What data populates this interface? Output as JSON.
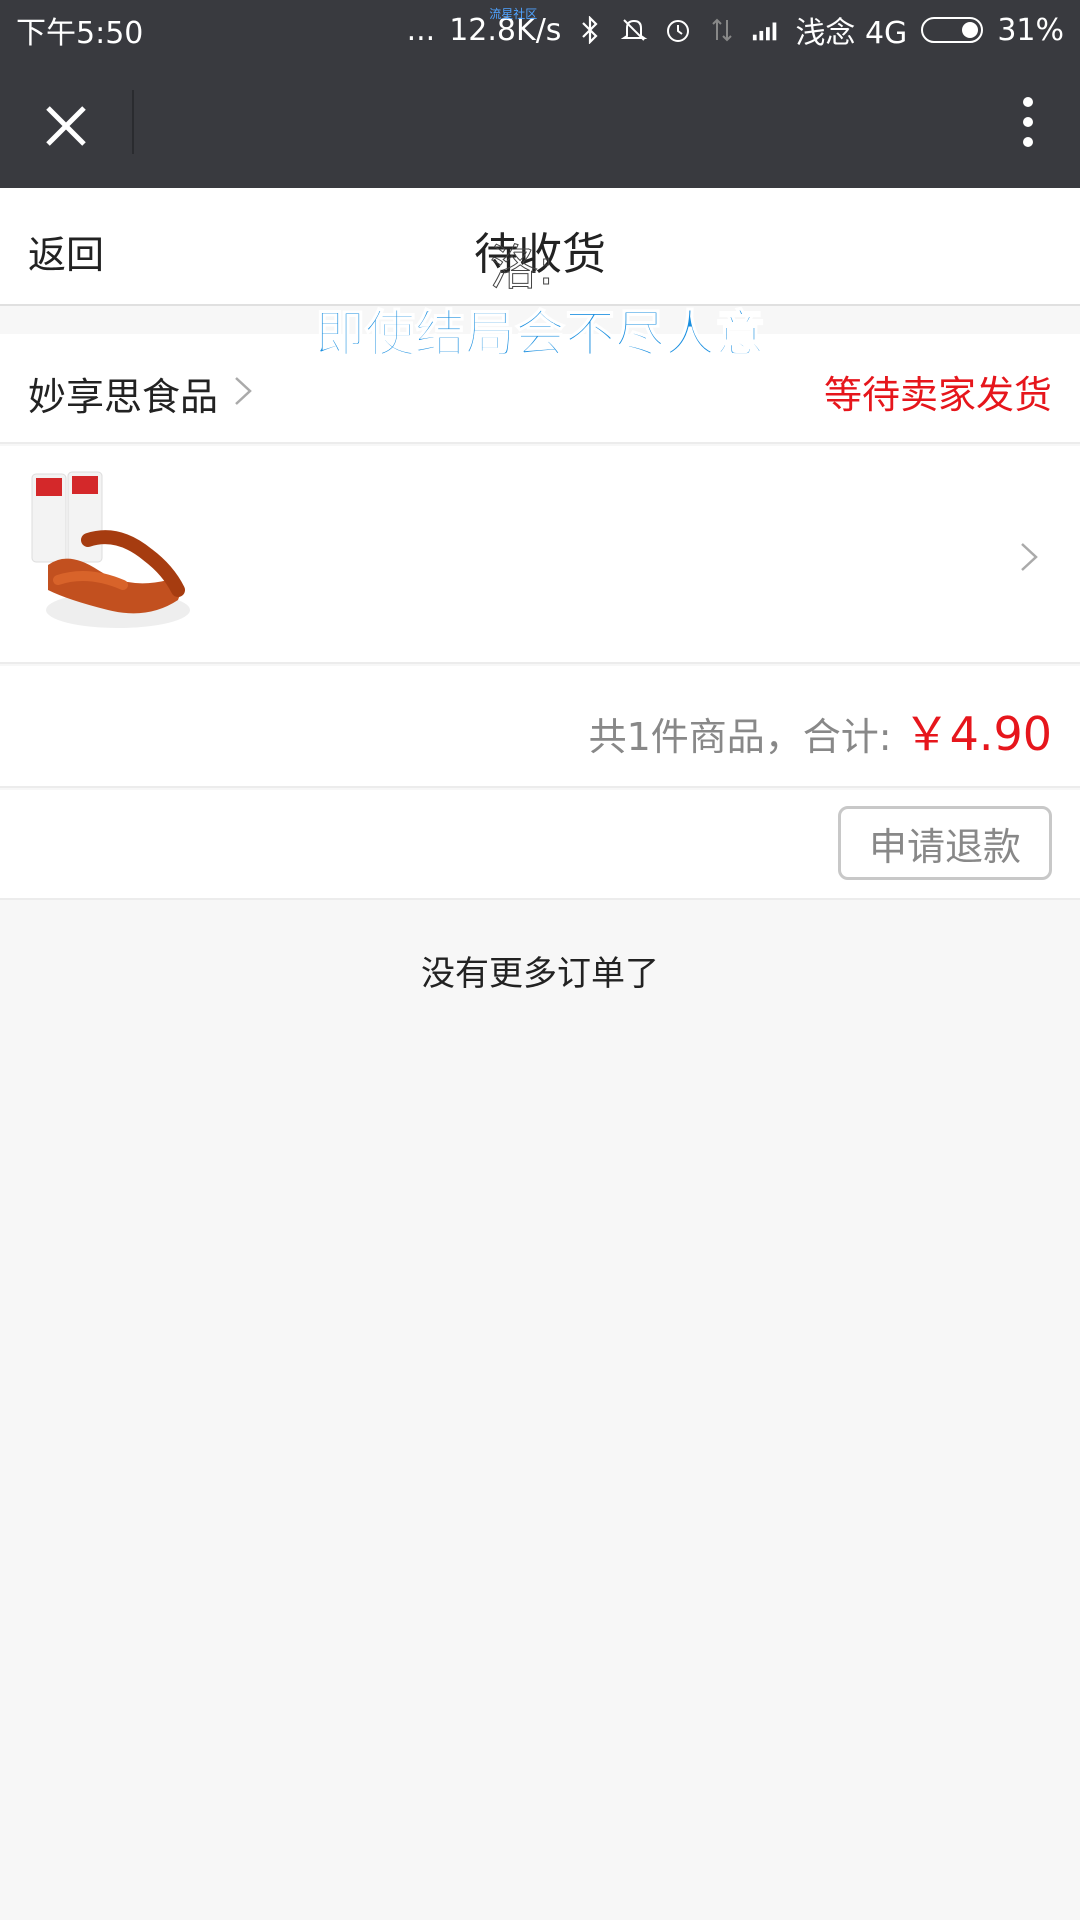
{
  "status_bar": {
    "time": "下午5:50",
    "dots": "...",
    "net_speed": "12.8K/s",
    "overlay_label": "流星社区",
    "carrier": "浅念 4G",
    "battery": "31%",
    "battery_level": 0.31
  },
  "header": {
    "back_label": "返回",
    "title": "待收货",
    "title_overlay": "洛:"
  },
  "overlay_caption": "即使结局会不尽人意",
  "order": {
    "shop_name": "妙享思食品",
    "status": "等待卖家发货",
    "summary_label": "共1件商品，合计:",
    "total_price": "￥4.90",
    "refund_button_label": "申请退款"
  },
  "footer_note": "没有更多订单了",
  "icons": {
    "close": "close-icon",
    "more": "more-vertical-icon",
    "chevron": "chevron-right-icon",
    "bluetooth": "bluetooth-icon",
    "mute": "mute-icon",
    "alarm": "alarm-icon",
    "data": "data-arrows-icon",
    "signal": "signal-icon",
    "battery": "battery-icon"
  },
  "colors": {
    "dark_bar": "#393a3f",
    "accent_red": "#e6161c",
    "caption_blue": "#1a8fe0"
  }
}
